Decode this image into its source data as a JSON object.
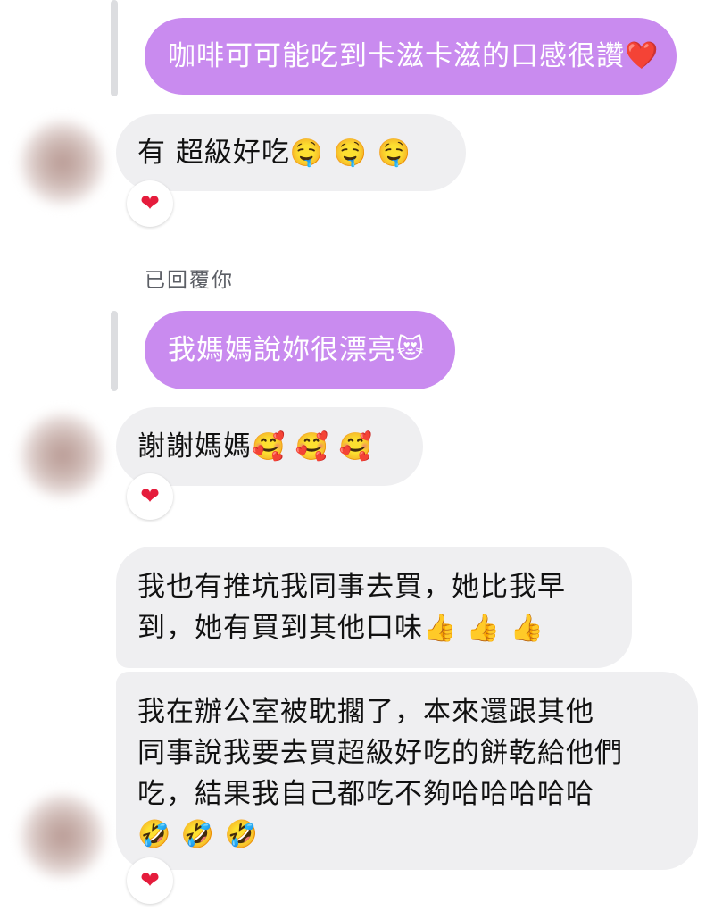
{
  "messages": {
    "m1": {
      "text": "咖啡可可能吃到卡滋卡滋的口感很讚",
      "emoji": "❤️"
    },
    "m2": {
      "text": "有 超級好吃",
      "emoji": "🤤 🤤 🤤",
      "reaction": "❤"
    },
    "replied_label": "已回覆你",
    "m3": {
      "text": "我媽媽說妳很漂亮",
      "emoji": "😻"
    },
    "m4": {
      "text": "謝謝媽媽",
      "emoji": "🥰 🥰 🥰",
      "reaction": "❤"
    },
    "m5": {
      "line1": "我也有推坑我同事去買，她比我早",
      "line2": "到，她有買到其他口味",
      "emoji": "👍 👍 👍"
    },
    "m6": {
      "line1": "我在辦公室被耽擱了，本來還跟其他",
      "line2": "同事說我要去買超級好吃的餅乾給他們",
      "line3": "吃，結果我自己都吃不夠哈哈哈哈哈",
      "emoji": "🤣 🤣 🤣",
      "reaction": "❤"
    }
  },
  "colors": {
    "outgoing": "#c98bef",
    "incoming": "#efeff1",
    "heart": "#e51c3c"
  }
}
